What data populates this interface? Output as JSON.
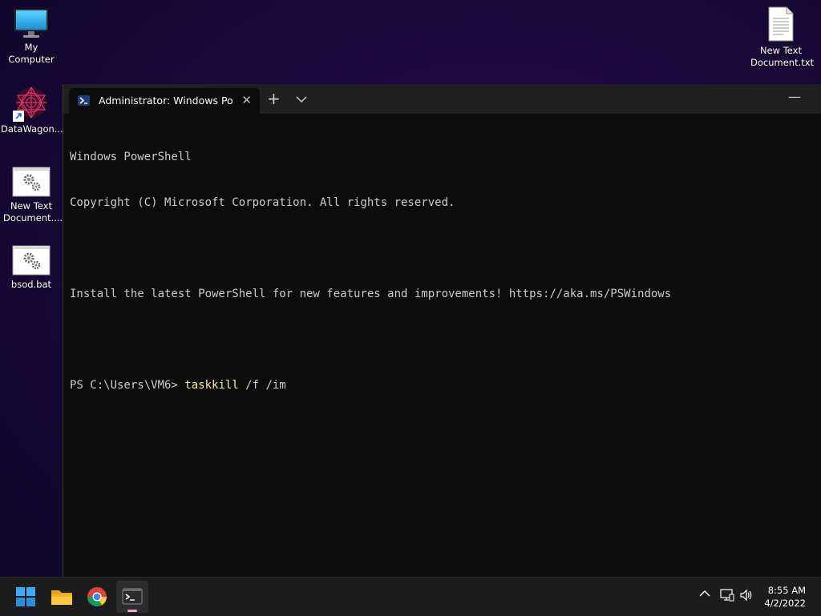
{
  "desktop": {
    "icons": [
      {
        "label": "My Computer"
      },
      {
        "label": "DataWagon..."
      },
      {
        "label": "New Text Document...."
      },
      {
        "label": "bsod.bat"
      },
      {
        "label": "New Text Document.txt"
      }
    ]
  },
  "terminal": {
    "tab_title": "Administrator: Windows PowerShell",
    "tab_close": "✕",
    "new_tab": "+",
    "dropdown": "⌄",
    "minimize": "—",
    "lines": [
      "Windows PowerShell",
      "Copyright (C) Microsoft Corporation. All rights reserved.",
      "",
      "Install the latest PowerShell for new features and improvements! https://aka.ms/PSWindows",
      ""
    ],
    "prompt": "PS C:\\Users\\VM6> ",
    "command": "taskkill",
    "args": " /f /im"
  },
  "taskbar": {
    "apps": [
      "start-icon",
      "file-explorer-icon",
      "chrome-icon",
      "terminal-icon"
    ],
    "tray_chevron": "︿",
    "time": "8:55 AM",
    "date": "4/2/2022"
  },
  "colors": {
    "terminal_bg": "#0c0c0c",
    "command_color": "#f9f1a5",
    "taskbar_bg": "#1c1c1c"
  }
}
